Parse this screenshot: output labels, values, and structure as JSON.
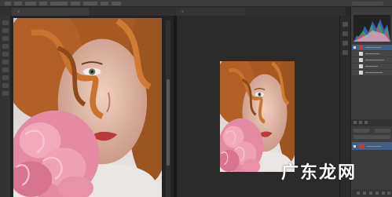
{
  "options_bar": {
    "chips": 9
  },
  "tabs": [
    {
      "label": ""
    },
    {
      "label": ""
    }
  ],
  "panels": {
    "top_tabs": [
      "",
      ""
    ],
    "histogram_icon": "histogram-graph",
    "layers_icon": "layer-thumbnails"
  },
  "watermark": {
    "text": "广东龙网"
  },
  "colors": {
    "chrome": "#3c3c3c",
    "canvas_bg": "#262626",
    "selection": "#3e5f86",
    "layer_thumb_red": "#c23b3b"
  }
}
